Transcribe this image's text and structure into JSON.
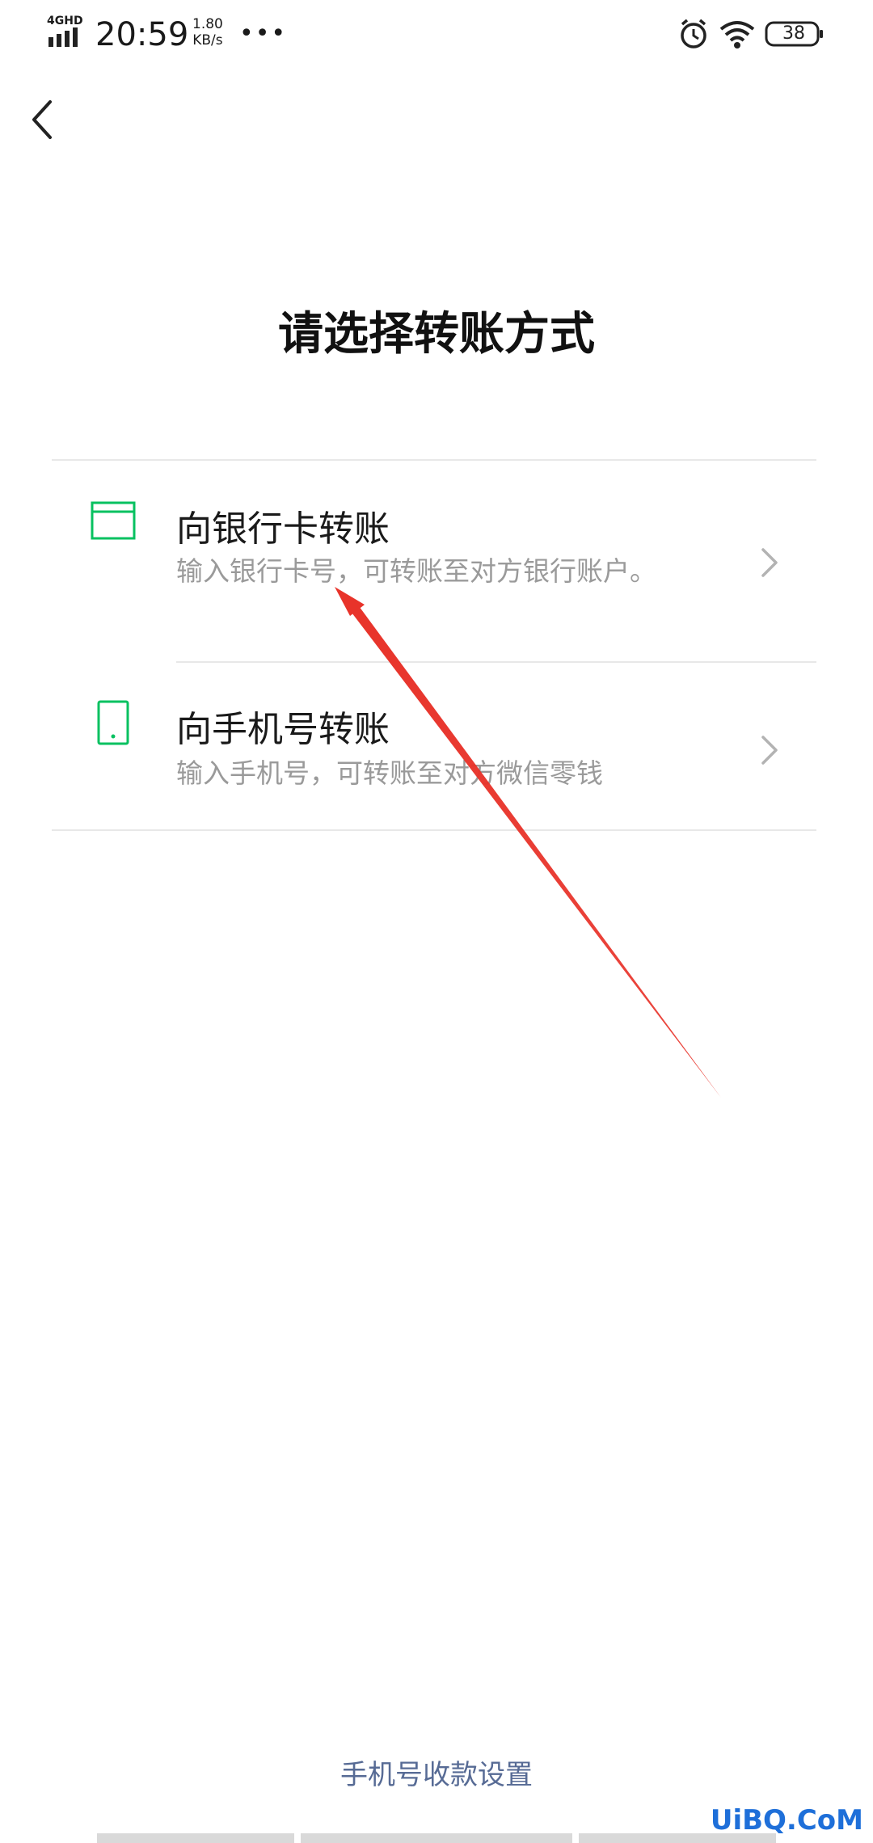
{
  "status_bar": {
    "network": "4GHD",
    "time": "20:59",
    "speed_value": "1.80",
    "speed_unit": "KB/s",
    "more": "•••",
    "battery": "38"
  },
  "page": {
    "title": "请选择转账方式"
  },
  "options": [
    {
      "title": "向银行卡转账",
      "description": "输入银行卡号，可转账至对方银行账户。",
      "icon": "bank-card-icon"
    },
    {
      "title": "向手机号转账",
      "description": "输入手机号，可转账至对方微信零钱",
      "icon": "phone-icon"
    }
  ],
  "footer": {
    "link": "手机号收款设置"
  },
  "watermark": "UiBQ.CoM",
  "colors": {
    "accent_green": "#07c160",
    "link_blue": "#576b95",
    "annotation_red": "#e8332a"
  }
}
